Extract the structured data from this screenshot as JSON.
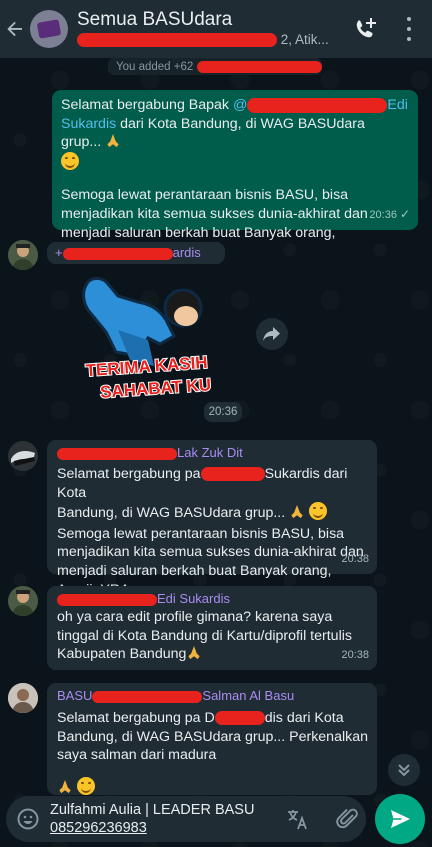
{
  "header": {
    "title": "Semua BASUdara",
    "subtitle_visible_end": "2, Atik..."
  },
  "system_notice": {
    "text": "You added +62"
  },
  "messages": [
    {
      "id": "m1",
      "direction": "outgoing",
      "line1_prefix": "Selamat bergabung Bapak ",
      "mention_start": "@",
      "mention_end": "Edi",
      "mention_line2": "Sukardis",
      "line2_rest": " dari Kota Bandung, di WAG BASUdara grup... ",
      "body2": "Semoga lewat perantaraan bisnis BASU, bisa menjadikan kita semua sukses dunia-akhirat dan menjadi saluran berkah buat Banyak orang, AamiinYRA",
      "time": "20:36"
    },
    {
      "id": "m2",
      "direction": "incoming",
      "sender_prefix": "+",
      "sender_suffix": "ardis",
      "sticker_text_line1": "TERIMA KASIH",
      "sticker_text_line2": "SAHABAT KU",
      "time": "20:36"
    },
    {
      "id": "m3",
      "direction": "incoming",
      "sender_suffix": "Lak Zuk Dit",
      "body_part1": "Selamat bergabung pa",
      "body_part2": "Sukardis dari Kota",
      "body_line2": "Bandung, di WAG BASUdara grup... ",
      "body2": "Semoga lewat perantaraan bisnis BASU, bisa menjadikan kita semua sukses dunia-akhirat dan menjadi saluran berkah buat Banyak orang, AamiinYRA",
      "time": "20:38"
    },
    {
      "id": "m4",
      "direction": "incoming",
      "sender_suffix": "Edi Sukardis",
      "body": "oh ya cara edit profile gimana? karena saya tinggal di Kota Bandung di Kartu/diprofil tertulis Kabupaten Bandung",
      "time": "20:38"
    },
    {
      "id": "m5",
      "direction": "incoming",
      "sender_prefix": "BASU",
      "sender_suffix": "Salman Al Basu",
      "body_part1": "Selamat bergabung pa D",
      "body_part2": "dis dari Kota",
      "body_line2": "Bandung, di WAG BASUdara grup... Perkenalkan saya salman dari madura"
    }
  ],
  "time_divider": "20:36",
  "composer": {
    "line1": "Zulfahmi Aulia | LEADER BASU",
    "line2": "085296236983"
  },
  "icons": {
    "back": "back-arrow-icon",
    "call_add": "add-call-icon",
    "menu": "more-vert-icon",
    "forward": "forward-icon",
    "scroll": "double-chevron-down-icon",
    "emoji": "emoji-icon",
    "translate": "translate-icon",
    "attach": "paperclip-icon",
    "send": "send-icon"
  },
  "colors": {
    "header_bg": "#1f2c34",
    "outgoing_bubble": "#005c4b",
    "incoming_bubble": "#1f2c34",
    "accent": "#00a884",
    "sender_name": "#a98cf2",
    "mention": "#53bdeb"
  }
}
